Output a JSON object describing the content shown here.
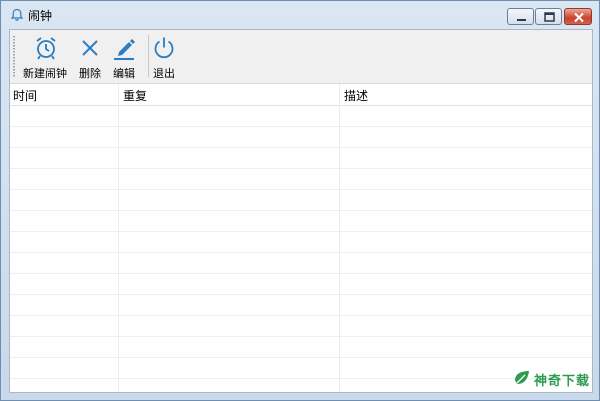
{
  "window": {
    "title": "闹钟",
    "title_icon": "bell-icon",
    "controls": [
      "minimize-icon",
      "maximize-icon",
      "close-icon"
    ]
  },
  "toolbar": {
    "buttons": [
      {
        "label": "新建闹钟",
        "icon": "alarm-clock-icon"
      },
      {
        "label": "删除",
        "icon": "x-icon"
      },
      {
        "label": "编辑",
        "icon": "pencil-icon"
      },
      {
        "label": "退出",
        "icon": "power-icon"
      }
    ]
  },
  "table": {
    "columns": [
      "时间",
      "重复",
      "描述"
    ],
    "rows": []
  },
  "watermark": {
    "text": "神奇下载",
    "logo": "leaf-logo"
  },
  "colors": {
    "accent": "#2b7dc1",
    "watermark": "#2e9b54"
  }
}
